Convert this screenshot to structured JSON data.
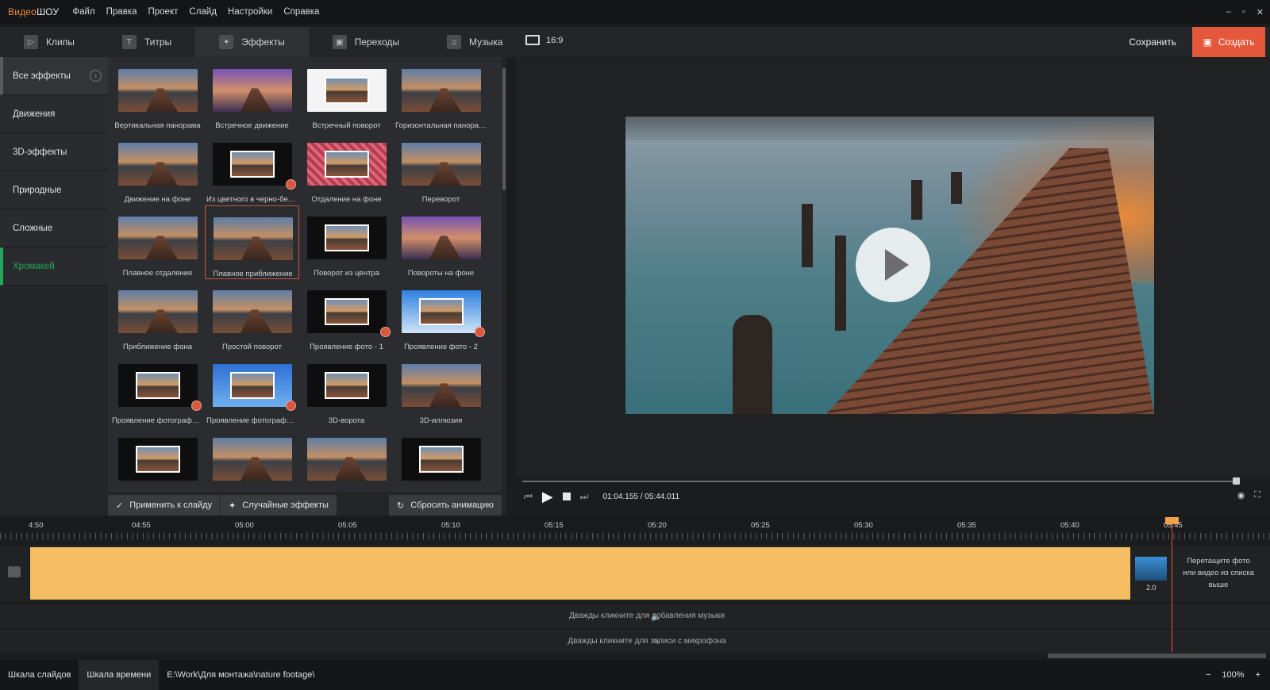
{
  "app": {
    "logo_a": "Видео",
    "logo_b": "ШОУ"
  },
  "menu": [
    "Файл",
    "Правка",
    "Проект",
    "Слайд",
    "Настройки",
    "Справка"
  ],
  "window_controls": [
    "–",
    "▫",
    "✕"
  ],
  "tabs": [
    {
      "label": "Клипы",
      "icon": "clips-icon",
      "glyph": "▷"
    },
    {
      "label": "Титры",
      "icon": "titles-icon",
      "glyph": "T"
    },
    {
      "label": "Эффекты",
      "icon": "effects-icon",
      "glyph": "✦",
      "active": true
    },
    {
      "label": "Переходы",
      "icon": "transitions-icon",
      "glyph": "▣"
    },
    {
      "label": "Музыка",
      "icon": "music-icon",
      "glyph": "♫"
    }
  ],
  "categories": [
    {
      "label": "Все эффекты",
      "arrow": "›"
    },
    {
      "label": "Движения"
    },
    {
      "label": "3D-эффекты"
    },
    {
      "label": "Природные"
    },
    {
      "label": "Сложные"
    },
    {
      "label": "Хромакей"
    }
  ],
  "effects": [
    {
      "label": "Вертикальная панорама",
      "style": "photo"
    },
    {
      "label": "Встречное движение",
      "style": "purple"
    },
    {
      "label": "Встречный поворот",
      "style": "white"
    },
    {
      "label": "Горизонтальная панорама",
      "style": "photo"
    },
    {
      "label": "Движение на фоне",
      "style": "photo"
    },
    {
      "label": "Из цветного в черно-белое",
      "style": "dark",
      "badge": true
    },
    {
      "label": "Отдаление на фоне",
      "style": "pink"
    },
    {
      "label": "Переворот",
      "style": "photo"
    },
    {
      "label": "Плавное отдаление",
      "style": "photo"
    },
    {
      "label": "Плавное приближение",
      "style": "photo",
      "selected": true
    },
    {
      "label": "Поворот из центра",
      "style": "dark"
    },
    {
      "label": "Повороты на фоне",
      "style": "purple"
    },
    {
      "label": "Приближение фона",
      "style": "photo"
    },
    {
      "label": "Простой поворот",
      "style": "photo"
    },
    {
      "label": "Проявление фото - 1",
      "style": "dark",
      "badge": true
    },
    {
      "label": "Проявление фото - 2",
      "style": "sky",
      "badge": true
    },
    {
      "label": "Проявление фотографии…",
      "style": "dark",
      "badge": true
    },
    {
      "label": "Проявление фотографии…",
      "style": "blue",
      "badge": true
    },
    {
      "label": "3D-ворота",
      "style": "dark"
    },
    {
      "label": "3D-иллюзия",
      "style": "photo"
    },
    {
      "label": "",
      "style": "dark"
    },
    {
      "label": "",
      "style": "photo"
    },
    {
      "label": "",
      "style": "photo"
    },
    {
      "label": "",
      "style": "dark"
    }
  ],
  "buttons": {
    "apply": "Применить к слайду",
    "random": "Случайные эффекты",
    "reset": "Сбросить анимацию"
  },
  "preview": {
    "ratio": "16:9",
    "save": "Сохранить",
    "create": "Создать",
    "time": "01:04.155 / 05:44.011"
  },
  "timeline": {
    "ticks": [
      "4:50",
      "04:55",
      "05:00",
      "05:05",
      "05:10",
      "05:15",
      "05:20",
      "05:25",
      "05:30",
      "05:35",
      "05:40",
      "05:45"
    ],
    "slide_duration": "2.0",
    "drop_hint": "Перетащите фото или видео из списка выше",
    "music_hint": "Дважды кликните для добавления музыки",
    "mic_hint": "Дважды кликните для записи с микрофона"
  },
  "status": {
    "slides": "Шкала слайдов",
    "timeline": "Шкала времени",
    "path": "E:\\Work\\Для монтажа\\nature footage\\",
    "zoom": "100%"
  },
  "colors": {
    "accent": "#e4573a",
    "chroma_green": "#23a85a",
    "audio_track": "#f5be62"
  }
}
